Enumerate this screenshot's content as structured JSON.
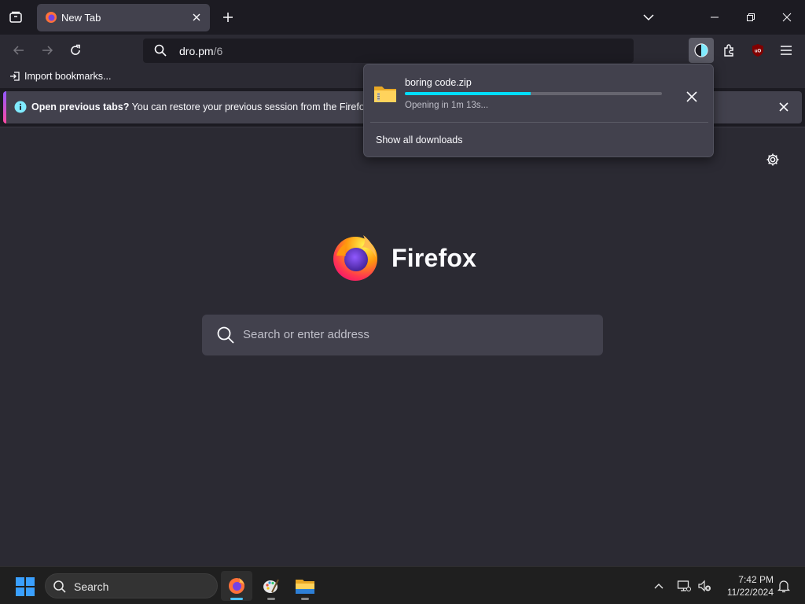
{
  "tab": {
    "title": "New Tab"
  },
  "navbar": {
    "url_host": "dro.pm",
    "url_path": "/6"
  },
  "bookmarks": {
    "import_label": "Import bookmarks..."
  },
  "notification": {
    "bold": "Open previous tabs?",
    "text": " You can restore your previous session from the Firefox appli"
  },
  "newtab": {
    "wordmark": "Firefox",
    "search_placeholder": "Search or enter address"
  },
  "downloads": {
    "filename": "boring code.zip",
    "status": "Opening in 1m 13s...",
    "progress": 0.49,
    "show_all": "Show all downloads"
  },
  "taskbar": {
    "search_label": "Search",
    "time": "7:42 PM",
    "date": "11/22/2024"
  },
  "colors": {
    "accent": "#00ddff",
    "windows_blue": "#3aa0ff"
  }
}
